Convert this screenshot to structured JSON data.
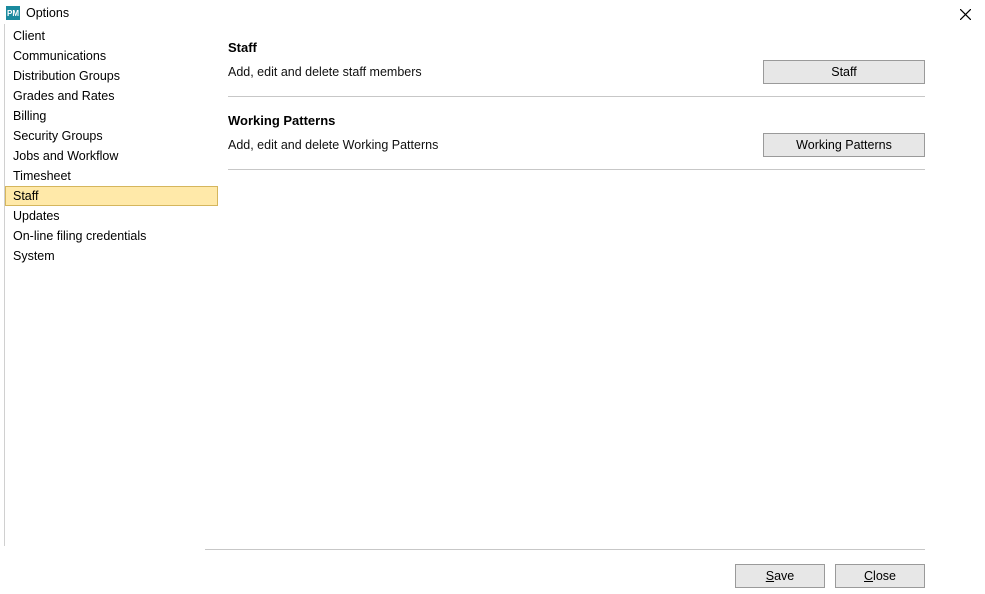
{
  "window": {
    "title": "Options",
    "icon_text": "PM"
  },
  "sidebar": {
    "items": [
      {
        "label": "Client",
        "selected": false
      },
      {
        "label": "Communications",
        "selected": false
      },
      {
        "label": "Distribution Groups",
        "selected": false
      },
      {
        "label": "Grades and Rates",
        "selected": false
      },
      {
        "label": "Billing",
        "selected": false
      },
      {
        "label": "Security Groups",
        "selected": false
      },
      {
        "label": "Jobs and Workflow",
        "selected": false
      },
      {
        "label": "Timesheet",
        "selected": false
      },
      {
        "label": "Staff",
        "selected": true
      },
      {
        "label": "Updates",
        "selected": false
      },
      {
        "label": "On-line filing credentials",
        "selected": false
      },
      {
        "label": "System",
        "selected": false
      }
    ]
  },
  "sections": [
    {
      "title": "Staff",
      "desc": "Add, edit and delete staff members",
      "button": "Staff"
    },
    {
      "title": "Working Patterns",
      "desc": "Add, edit and delete Working Patterns",
      "button": "Working Patterns"
    }
  ],
  "footer": {
    "save": "Save",
    "close": "Close"
  }
}
